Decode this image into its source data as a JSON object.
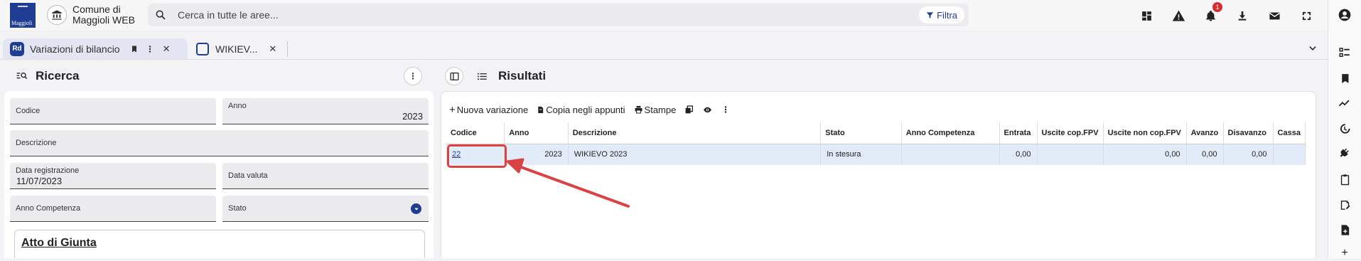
{
  "app": {
    "logo_text": "Maggioli",
    "title_line1": "Comune di",
    "title_line2": "Maggioli WEB"
  },
  "search": {
    "placeholder": "Cerca in tutte le aree...",
    "filter_label": "Filtra"
  },
  "notifications": {
    "count": "1"
  },
  "tabs": [
    {
      "label": "Variazioni di bilancio",
      "icon": "Rd"
    },
    {
      "label": "WIKIEV..."
    }
  ],
  "left": {
    "title": "Ricerca",
    "fields": {
      "codice": {
        "label": "Codice",
        "value": ""
      },
      "anno": {
        "label": "Anno",
        "value": "2023"
      },
      "descrizione": {
        "label": "Descrizione",
        "value": ""
      },
      "data_registrazione": {
        "label": "Data registrazione",
        "value": "11/07/2023"
      },
      "data_valuta": {
        "label": "Data valuta",
        "value": ""
      },
      "anno_competenza": {
        "label": "Anno Competenza",
        "value": ""
      },
      "stato": {
        "label": "Stato",
        "value": ""
      }
    },
    "section_title": "Atto di Giunta"
  },
  "right": {
    "title": "Risultati",
    "toolbar": {
      "new_label": "Nuova variazione",
      "copy_label": "Copia negli appunti",
      "print_label": "Stampe"
    },
    "columns": [
      "Codice",
      "Anno",
      "Descrizione",
      "Stato",
      "Anno Competenza",
      "Entrata",
      "Uscite cop.FPV",
      "Uscite non cop.FPV",
      "Avanzo",
      "Disavanzo",
      "Cassa"
    ],
    "rows": [
      {
        "codice": "22",
        "anno": "2023",
        "descrizione": "WIKIEVO 2023",
        "stato": "In stesura",
        "anno_competenza": "",
        "entrata": "0,00",
        "uscite_cop": "",
        "uscite_non_cop": "0,00",
        "avanzo": "0,00",
        "disavanzo": "0,00",
        "cassa": ""
      }
    ]
  },
  "colors": {
    "brand": "#1f3d93",
    "row_selected": "#e2ecf8",
    "annotation": "#d94343"
  }
}
